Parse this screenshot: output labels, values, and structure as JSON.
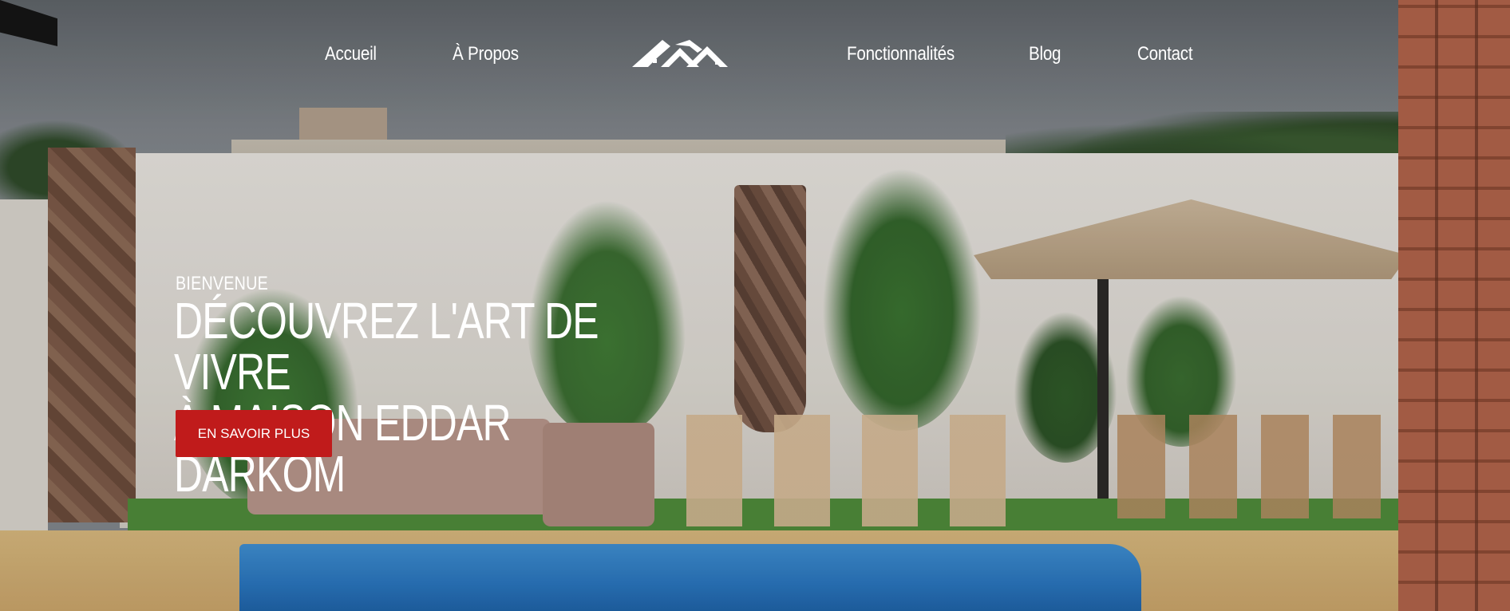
{
  "nav": {
    "items": [
      {
        "label": "Accueil"
      },
      {
        "label": "À Propos"
      },
      {
        "label": "Fonctionnalités"
      },
      {
        "label": "Blog"
      },
      {
        "label": "Contact"
      }
    ],
    "logo_icon": "house-roofs-logo"
  },
  "hero": {
    "eyebrow": "BIENVENUE",
    "headline_line1": "DÉCOUVREZ L'ART DE VIVRE",
    "headline_line2": "À MAISON EDDAR DARKOM",
    "cta_label": "EN SAVOIR PLUS"
  },
  "colors": {
    "cta_background": "#c01b1b",
    "nav_text": "#ffffff"
  }
}
